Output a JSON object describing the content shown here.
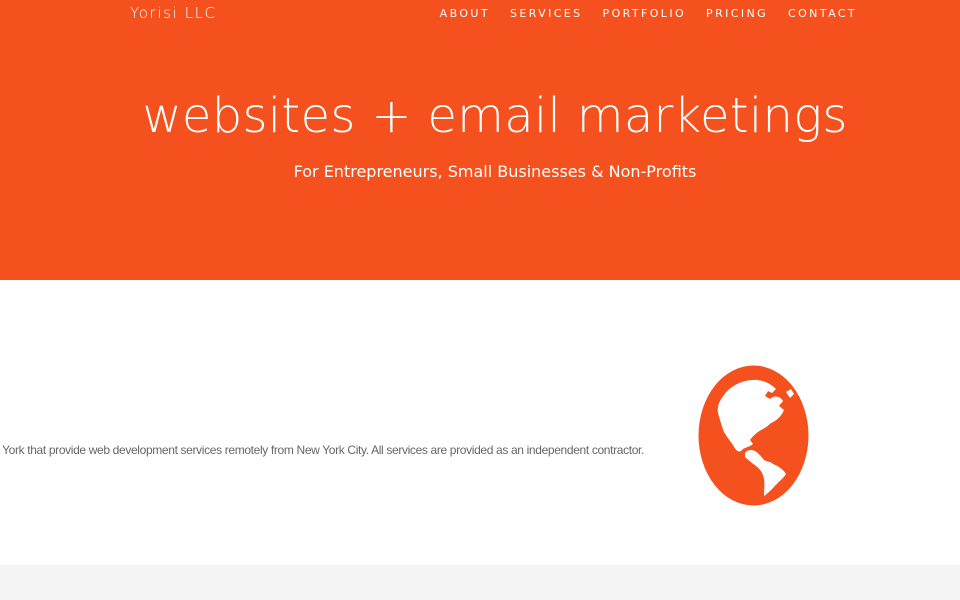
{
  "theme": {
    "accent": "#f4511e",
    "text_light": "#ffffff",
    "body_text": "#666666",
    "footer_bg": "#f4f4f4"
  },
  "navbar": {
    "brand": "Yorisi LLC",
    "items": [
      {
        "label": "ABOUT"
      },
      {
        "label": "SERVICES"
      },
      {
        "label": "PORTFOLIO"
      },
      {
        "label": "PRICING"
      },
      {
        "label": "CONTACT"
      }
    ]
  },
  "hero": {
    "title": "websites + email marketings",
    "subtitle": "For Entrepreneurs, Small Businesses & Non-Profits"
  },
  "about": {
    "text": "gal entity formed in New York that provide web development services remotely from New York City. All services are provided as an independent contractor.",
    "icon": "globe-icon"
  }
}
